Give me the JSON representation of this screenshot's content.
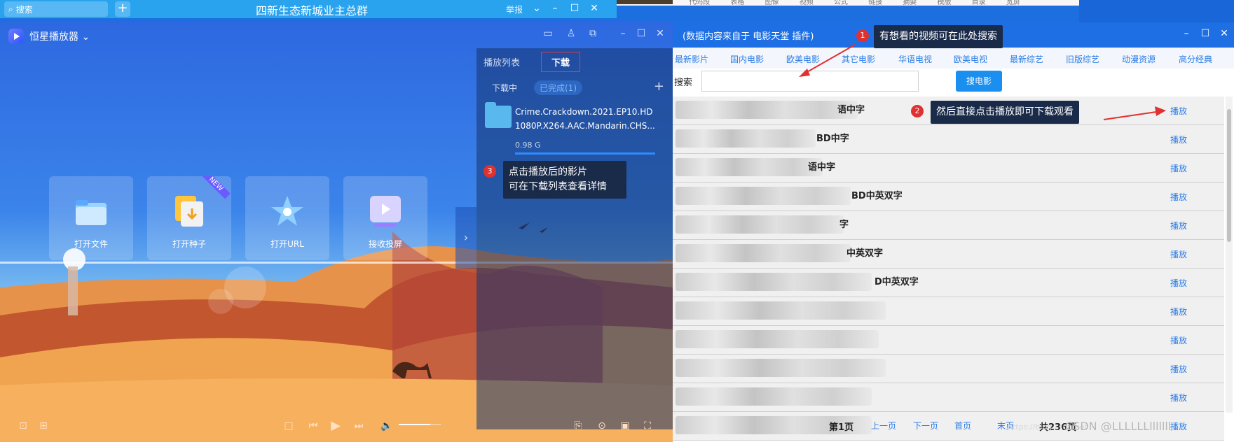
{
  "chat_window": {
    "search_placeholder": "搜索",
    "title": "四新生态新城业主总群",
    "report": "举报"
  },
  "doc_strip": [
    "代码段",
    "表格",
    "图像",
    "视频",
    "公式",
    "链接",
    "摘要",
    "模版",
    "目录",
    "宽屏"
  ],
  "player": {
    "app_name": "恒星播放器",
    "tiles": [
      {
        "label": "打开文件",
        "icon": "folder-icon"
      },
      {
        "label": "打开种子",
        "icon": "torrent-icon",
        "badge": "NEW"
      },
      {
        "label": "打开URL",
        "icon": "star-icon"
      },
      {
        "label": "接收投屏",
        "icon": "cast-icon"
      }
    ],
    "volume_fraction": 0.75
  },
  "download_panel": {
    "tab_playlist": "播放列表",
    "tab_download": "下载",
    "sub_downloading": "下载中",
    "sub_completed": "已完成(1)",
    "file_line1": "Crime.Crackdown.2021.EP10.HD",
    "file_line2": "1080P.X264.AAC.Mandarin.CHS...",
    "file_size": "0.98 G",
    "progress_fraction": 1.0
  },
  "annotations": {
    "step1_num": "1",
    "step1_text": "有想看的视频可在此处搜索",
    "step2_num": "2",
    "step2_text": "然后直接点击播放即可下载观看",
    "step3_num": "3",
    "step3_line1": "点击播放后的影片",
    "step3_line2": "可在下载列表查看详情"
  },
  "plugin": {
    "title": "(数据内容来自于 电影天堂 插件)",
    "categories": [
      "最新影片",
      "国内电影",
      "欧美电影",
      "其它电影",
      "华语电视",
      "欧美电视",
      "最新综艺",
      "旧版综艺",
      "动漫资源",
      "高分经典"
    ],
    "search_label": "搜索",
    "search_button": "搜电影",
    "play_label": "播放",
    "rows": [
      {
        "visible_title": "语中字"
      },
      {
        "visible_title": "BD中字"
      },
      {
        "visible_title": "语中字"
      },
      {
        "visible_title": "BD中英双字"
      },
      {
        "visible_title": "字"
      },
      {
        "visible_title": "中英双字"
      },
      {
        "visible_title": "D中英双字"
      },
      {
        "visible_title": ""
      },
      {
        "visible_title": ""
      },
      {
        "visible_title": ""
      },
      {
        "visible_title": ""
      },
      {
        "visible_title": ""
      }
    ],
    "pager": {
      "current": "第1页",
      "prev": "上一页",
      "next": "下一页",
      "first": "首页",
      "last": "末页",
      "total": "共236页"
    }
  },
  "watermark": "CSDN @LLLLLLlllllll",
  "watermark_faint": "https://blog.csdn.net"
}
